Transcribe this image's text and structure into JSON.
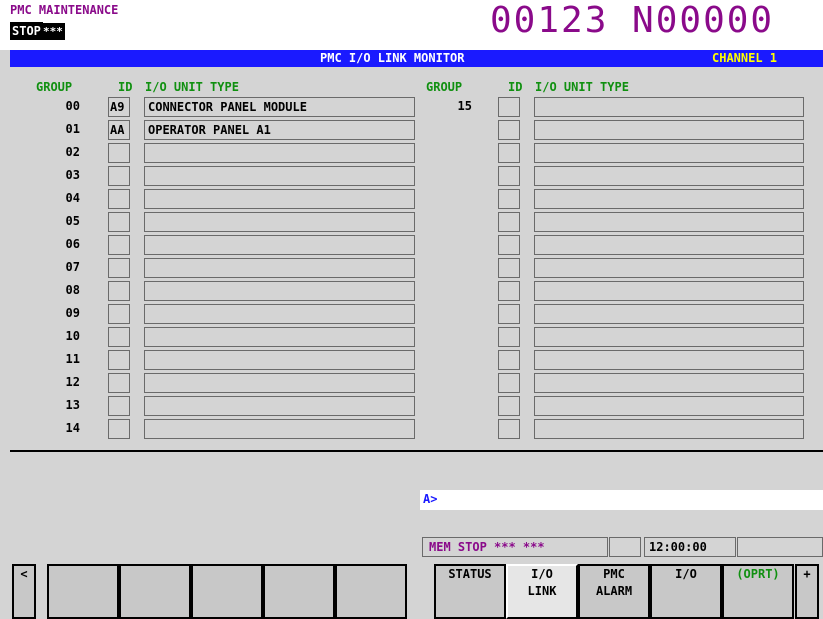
{
  "header": {
    "mode_title": "PMC MAINTENANCE",
    "stop_label": "STOP",
    "stop_stars": "***",
    "program_number": "00123 N00000"
  },
  "title_bar": {
    "title": "PMC I/O LINK MONITOR",
    "channel": "CHANNEL 1"
  },
  "columns": {
    "group": "GROUP",
    "id": "ID",
    "type": "I/O UNIT TYPE"
  },
  "left_rows": [
    {
      "group": "00",
      "id": "A9",
      "type": "CONNECTOR PANEL MODULE"
    },
    {
      "group": "01",
      "id": "AA",
      "type": "OPERATOR PANEL A1"
    },
    {
      "group": "02",
      "id": "",
      "type": ""
    },
    {
      "group": "03",
      "id": "",
      "type": ""
    },
    {
      "group": "04",
      "id": "",
      "type": ""
    },
    {
      "group": "05",
      "id": "",
      "type": ""
    },
    {
      "group": "06",
      "id": "",
      "type": ""
    },
    {
      "group": "07",
      "id": "",
      "type": ""
    },
    {
      "group": "08",
      "id": "",
      "type": ""
    },
    {
      "group": "09",
      "id": "",
      "type": ""
    },
    {
      "group": "10",
      "id": "",
      "type": ""
    },
    {
      "group": "11",
      "id": "",
      "type": ""
    },
    {
      "group": "12",
      "id": "",
      "type": ""
    },
    {
      "group": "13",
      "id": "",
      "type": ""
    },
    {
      "group": "14",
      "id": "",
      "type": ""
    }
  ],
  "right_rows": [
    {
      "group": "15",
      "id": "",
      "type": ""
    },
    {
      "group": "",
      "id": "",
      "type": ""
    },
    {
      "group": "",
      "id": "",
      "type": ""
    },
    {
      "group": "",
      "id": "",
      "type": ""
    },
    {
      "group": "",
      "id": "",
      "type": ""
    },
    {
      "group": "",
      "id": "",
      "type": ""
    },
    {
      "group": "",
      "id": "",
      "type": ""
    },
    {
      "group": "",
      "id": "",
      "type": ""
    },
    {
      "group": "",
      "id": "",
      "type": ""
    },
    {
      "group": "",
      "id": "",
      "type": ""
    },
    {
      "group": "",
      "id": "",
      "type": ""
    },
    {
      "group": "",
      "id": "",
      "type": ""
    },
    {
      "group": "",
      "id": "",
      "type": ""
    },
    {
      "group": "",
      "id": "",
      "type": ""
    },
    {
      "group": "",
      "id": "",
      "type": ""
    }
  ],
  "input": {
    "prompt": "A>"
  },
  "status": {
    "mode": "MEM  STOP *** ***",
    "time": "12:00:00"
  },
  "soft_keys": {
    "prev": "<",
    "keys": [
      {
        "line1": "STATUS",
        "line2": ""
      },
      {
        "line1": "I/O",
        "line2": "LINK"
      },
      {
        "line1": "PMC",
        "line2": "ALARM"
      },
      {
        "line1": "I/O",
        "line2": ""
      },
      {
        "line1": "(OPRT)",
        "line2": ""
      }
    ],
    "next": "+"
  },
  "colors": {
    "title_bar": "#1a1aff",
    "header_text": "#8a0a8a",
    "column_header": "#109010",
    "channel": "#ffff00",
    "oprt_text": "#109010"
  }
}
